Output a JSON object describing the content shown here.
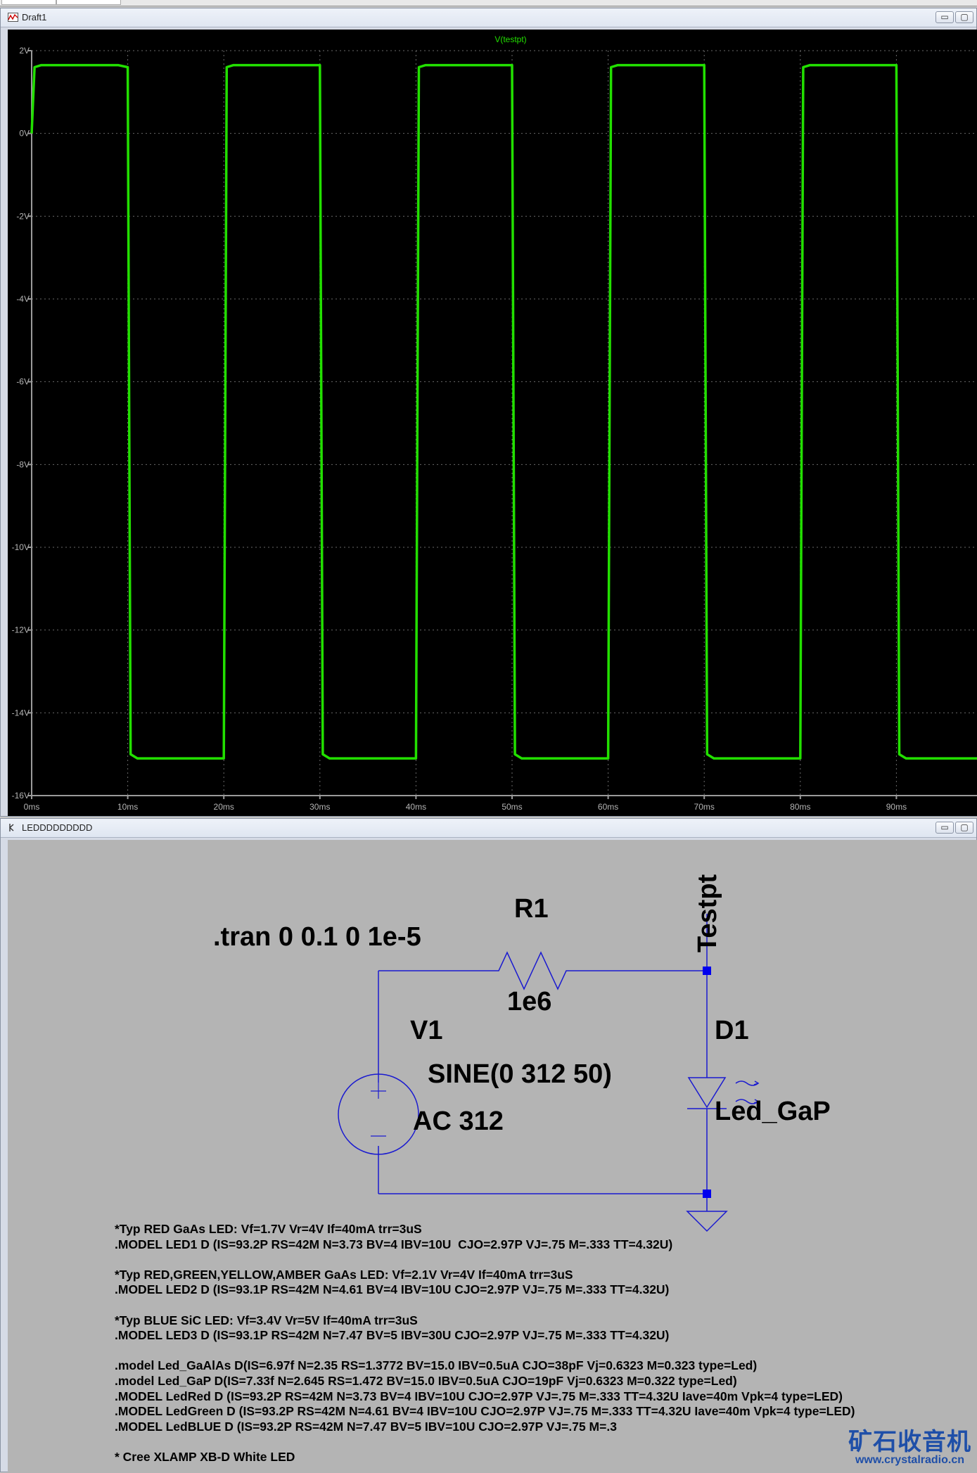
{
  "plot_window": {
    "title": "Draft1",
    "buttons": [
      "▭",
      "▢"
    ]
  },
  "schematic_window": {
    "title": "LEDDDDDDDDD",
    "buttons": [
      "▭",
      "▢"
    ]
  },
  "chart_data": {
    "type": "line",
    "title": "V(testpt)",
    "xlabel": "",
    "ylabel": "",
    "x_ticks": [
      "0ms",
      "10ms",
      "20ms",
      "30ms",
      "40ms",
      "50ms",
      "60ms",
      "70ms",
      "80ms",
      "90ms"
    ],
    "y_ticks": [
      "2V",
      "0V",
      "-2V",
      "-4V",
      "-6V",
      "-8V",
      "-10V",
      "-12V",
      "-14V",
      "-16V"
    ],
    "xlim": [
      0,
      100
    ],
    "ylim": [
      -16,
      2
    ],
    "grid": true,
    "series_color": "#22e000",
    "series": [
      {
        "name": "V(testpt)",
        "x": [
          0,
          0.3,
          1,
          9,
          10,
          10.3,
          11,
          20,
          20.3,
          21,
          30,
          30.3,
          31,
          40,
          40.3,
          41,
          50,
          50.3,
          51,
          60,
          60.3,
          61,
          70,
          70.3,
          71,
          80,
          80.3,
          81,
          90,
          90.3,
          91,
          100
        ],
        "y": [
          0,
          1.6,
          1.65,
          1.65,
          1.6,
          -15,
          -15.1,
          -15.1,
          1.6,
          1.65,
          1.65,
          -15,
          -15.1,
          -15.1,
          1.6,
          1.65,
          1.65,
          -15,
          -15.1,
          -15.1,
          1.6,
          1.65,
          1.65,
          -15,
          -15.1,
          -15.1,
          1.6,
          1.65,
          1.65,
          -15,
          -15.1,
          -15.1
        ]
      }
    ]
  },
  "schematic": {
    "directive": ".tran 0 0.1 0 1e-5",
    "r1_name": "R1",
    "r1_value": "1e6",
    "v1_name": "V1",
    "v1_value": "SINE(0 312 50)",
    "v1_ac": "AC 312",
    "d1_name": "D1",
    "d1_model": "Led_GaP",
    "net_label": "Testpt"
  },
  "spice_text": [
    "*Typ RED GaAs LED: Vf=1.7V Vr=4V If=40mA trr=3uS",
    ".MODEL LED1 D (IS=93.2P RS=42M N=3.73 BV=4 IBV=10U  CJO=2.97P VJ=.75 M=.333 TT=4.32U)",
    "",
    "*Typ RED,GREEN,YELLOW,AMBER GaAs LED: Vf=2.1V Vr=4V If=40mA trr=3uS",
    ".MODEL LED2 D (IS=93.1P RS=42M N=4.61 BV=4 IBV=10U CJO=2.97P VJ=.75 M=.333 TT=4.32U)",
    "",
    "*Typ BLUE SiC LED: Vf=3.4V Vr=5V If=40mA trr=3uS",
    ".MODEL LED3 D (IS=93.1P RS=42M N=7.47 BV=5 IBV=30U CJO=2.97P VJ=.75 M=.333 TT=4.32U)",
    "",
    ".model Led_GaAlAs D(IS=6.97f N=2.35 RS=1.3772 BV=15.0 IBV=0.5uA CJO=38pF Vj=0.6323 M=0.323 type=Led)",
    ".model Led_GaP D(IS=7.33f N=2.645 RS=1.472 BV=15.0 IBV=0.5uA CJO=19pF Vj=0.6323 M=0.322 type=Led)",
    ".MODEL LedRed D (IS=93.2P RS=42M N=3.73 BV=4 IBV=10U CJO=2.97P VJ=.75 M=.333 TT=4.32U Iave=40m Vpk=4 type=LED)",
    ".MODEL LedGreen D (IS=93.2P RS=42M N=4.61 BV=4 IBV=10U CJO=2.97P VJ=.75 M=.333 TT=4.32U Iave=40m Vpk=4 type=LED)",
    ".MODEL LedBLUE D (IS=93.2P RS=42M N=7.47 BV=5 IBV=10U CJO=2.97P VJ=.75 M=.3",
    "",
    "* Cree XLAMP XB-D White LED"
  ],
  "watermark": {
    "cn": "矿石收音机",
    "url": "www.crystalradio.cn"
  }
}
